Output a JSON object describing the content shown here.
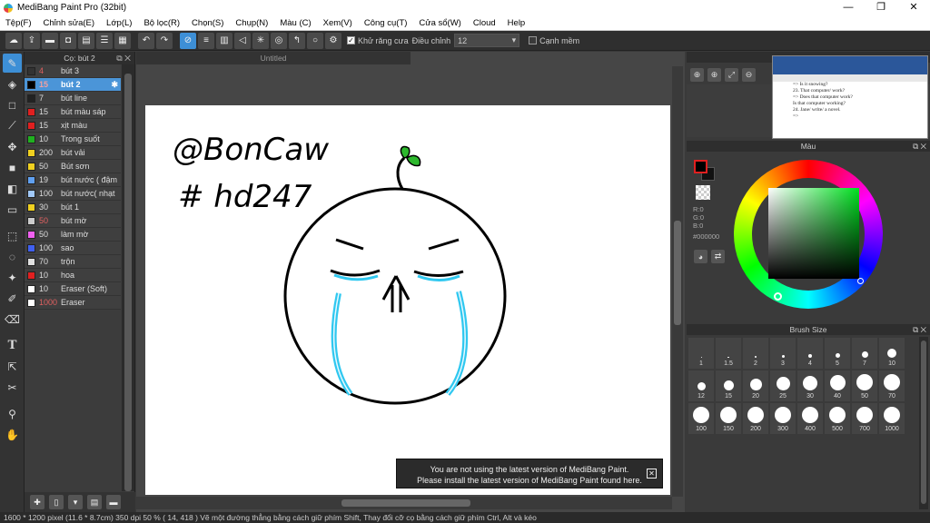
{
  "window": {
    "title": "MediBang Paint Pro (32bit)",
    "minimize": "—",
    "maximize": "❐",
    "close": "✕"
  },
  "menu": [
    "Tệp(F)",
    "Chỉnh sửa(E)",
    "Lớp(L)",
    "Bộ lọc(R)",
    "Chọn(S)",
    "Chụp(N)",
    "Màu (C)",
    "Xem(V)",
    "Công cụ(T)",
    "Cửa sổ(W)",
    "Cloud",
    "Help"
  ],
  "toolbar": {
    "antialias_label": "Khử răng cưa",
    "antialias_checked": "✓",
    "adjust_label": "Điều chỉnh",
    "adjust_value": "12",
    "edge_label": "Cạnh mềm"
  },
  "brush_panel": {
    "title": "Cọ: bút 2",
    "items": [
      {
        "size": "4",
        "name": "bút 3",
        "color": "#333333",
        "size_red": true
      },
      {
        "size": "15",
        "name": "bút 2",
        "color": "#000000",
        "size_red": true,
        "selected": true
      },
      {
        "size": "7",
        "name": "bút line",
        "color": "#222222",
        "size_red": false
      },
      {
        "size": "15",
        "name": "bút màu sáp",
        "color": "#e02020",
        "size_red": false
      },
      {
        "size": "15",
        "name": "xịt màu",
        "color": "#e02020",
        "size_red": false
      },
      {
        "size": "10",
        "name": "Trong suốt",
        "color": "#20b020",
        "size_red": false
      },
      {
        "size": "200",
        "name": "bút vải",
        "color": "#f0d020",
        "size_red": false
      },
      {
        "size": "50",
        "name": "Bút sơn",
        "color": "#f0d020",
        "size_red": false
      },
      {
        "size": "19",
        "name": "bút nước ( đậm",
        "color": "#60a0f0",
        "size_red": false
      },
      {
        "size": "100",
        "name": "bút nước( nhạt",
        "color": "#a0c8f8",
        "size_red": false
      },
      {
        "size": "30",
        "name": "bút 1",
        "color": "#f0d020",
        "size_red": false
      },
      {
        "size": "50",
        "name": "bút mờ",
        "color": "#cccccc",
        "size_red": true
      },
      {
        "size": "50",
        "name": "làm mờ",
        "color": "#f060f0",
        "size_red": false
      },
      {
        "size": "100",
        "name": "sao",
        "color": "#4060f0",
        "size_red": false
      },
      {
        "size": "70",
        "name": "trộn",
        "color": "#e0e0e0",
        "size_red": false
      },
      {
        "size": "10",
        "name": "hoa",
        "color": "#e02020",
        "size_red": false
      },
      {
        "size": "10",
        "name": "Eraser (Soft)",
        "color": "#ffffff",
        "size_red": false
      },
      {
        "size": "1000",
        "name": "Eraser",
        "color": "#ffffff",
        "size_red": true
      }
    ]
  },
  "canvas": {
    "tab": "Untitled",
    "drawing_text_1": "@BonCaw",
    "drawing_text_2": "# hd247",
    "notice_line_1": "You are not using the latest version of MediBang Paint.",
    "notice_line_2": "Please install the latest version of MediBang Paint found here.",
    "notice_close": "✕"
  },
  "navigator": {
    "doc_lines": [
      "=> Is it snowing?",
      "23. That computer/ work?",
      "=> Does that computer work?",
      "Is that computer working?",
      "24. Jane/ write/ a novel.",
      "=>"
    ]
  },
  "color_panel": {
    "title": "Màu",
    "r": "R:0",
    "g": "G:0",
    "b": "B:0",
    "hex": "#000000",
    "fg_color": "#000000",
    "border_color": "#e02020"
  },
  "brush_size": {
    "title": "Brush Size",
    "sizes": [
      "1",
      "1.5",
      "2",
      "3",
      "4",
      "5",
      "7",
      "10",
      "12",
      "15",
      "20",
      "25",
      "30",
      "40",
      "50",
      "70",
      "100",
      "150",
      "200",
      "300",
      "400",
      "500",
      "700",
      "1000"
    ]
  },
  "status": "1600 * 1200 pixel   (11.6 * 8.7cm)  350 dpi   50 %   ( 14, 418 )   Vẽ một đường thẳng bằng cách giữ phím Shift, Thay đổi cỡ cọ bằng cách giữ phím Ctrl, Alt và kéo"
}
